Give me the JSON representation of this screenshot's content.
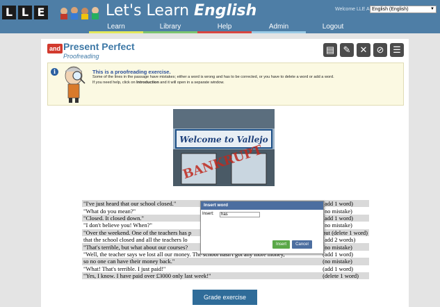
{
  "header": {
    "logo_letters": [
      "L",
      "L",
      "E"
    ],
    "app_title_plain": "Let's Learn ",
    "app_title_bold": "English",
    "welcome_text": "Welcome LLE Admin",
    "language_selected": "English (English)"
  },
  "nav": {
    "learn": "Learn",
    "library": "Library",
    "help": "Help",
    "admin": "Admin",
    "logout": "Logout"
  },
  "page": {
    "badge": "and",
    "title": "Present Perfect",
    "subtitle": "Proofreading"
  },
  "toolbar_icons": [
    "edit-icon",
    "pencil-icon",
    "close-icon",
    "block-icon",
    "list-icon"
  ],
  "info": {
    "title": "This is a proofreading exercise.",
    "line1": "Some of the lines in the passage have mistakes; either a word is wrong and has to be corrected, or you have to delete a word or add a word.",
    "line2_pre": "If you need help, click on ",
    "line2_link": "Introduction",
    "line2_post": " and it will open in a separate window."
  },
  "image": {
    "sign_text": "Welcome to Vallejo",
    "stamp_text": "BANKRUPT"
  },
  "exercise": {
    "rows": [
      {
        "text": "\"I've just heard that our school closed.\"",
        "action": "(add 1 word)"
      },
      {
        "text": "\"What do you mean?\"",
        "action": "(no mistake)"
      },
      {
        "text": "\"Closed. It closed down.\"",
        "action": "(add 1 word)"
      },
      {
        "text": "\"I don't believe you! When?\"",
        "action": "(no mistake)"
      },
      {
        "text": "\"Over the weekend. One of the teachers has p",
        "action": "but (delete 1 word)"
      },
      {
        "text": "that the school closed and all the teachers lo",
        "action": "(add 2 words)"
      },
      {
        "text": "\"That's terrible, but what about our courses?",
        "action": "(no mistake)"
      },
      {
        "text": "\"Well, the teacher says we lost all our money. The school hasn't got any more money,",
        "action": "(add 1 word)"
      },
      {
        "text": "so no one can have their money back.\"",
        "action": "(no mistake)"
      },
      {
        "text": "\"What! That's terrible. I just paid!\"",
        "action": "(add 1 word)"
      },
      {
        "text": "\"Yes, I know. I have paid over £3000 only last week!\"",
        "action": "(delete 1 word)"
      }
    ]
  },
  "dialog": {
    "title": "Insert word",
    "label": "Insert:",
    "input_value": "has",
    "insert_button": "Insert",
    "cancel_button": "Cancel"
  },
  "grade_button": "Grade exercise"
}
